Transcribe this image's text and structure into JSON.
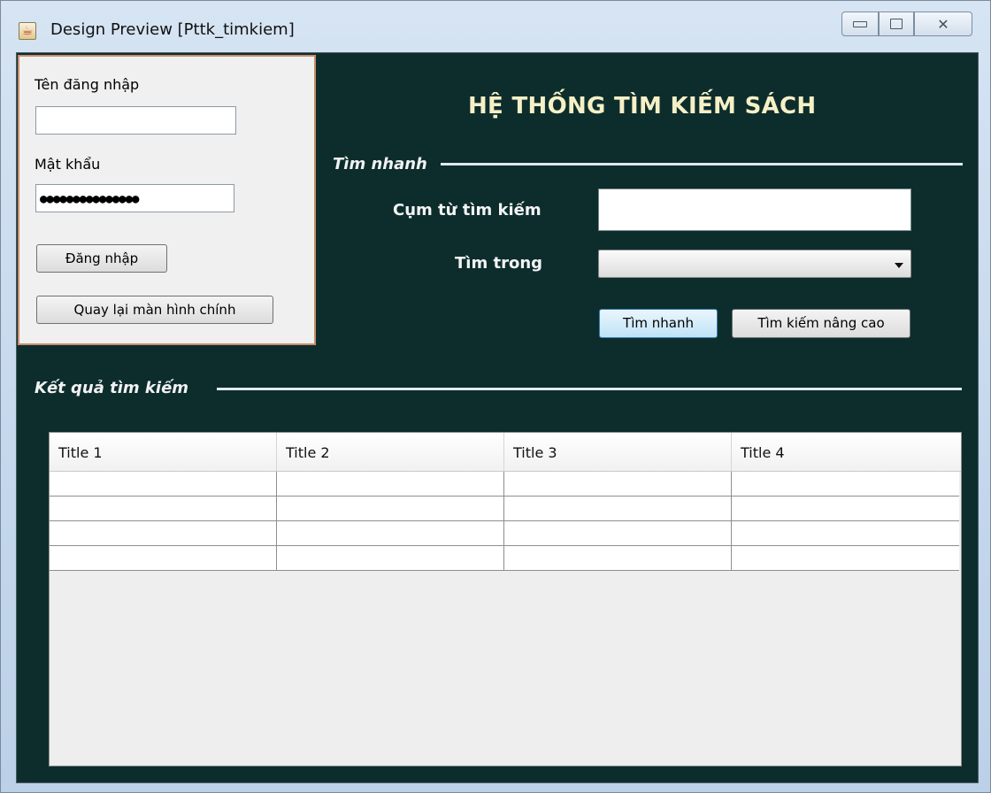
{
  "window": {
    "title": "Design Preview [Pttk_timkiem]",
    "controls": {
      "minimize": "",
      "maximize": "",
      "close": "✕"
    }
  },
  "login": {
    "username_label": "Tên đăng nhập",
    "username_value": "",
    "password_label": "Mật khẩu",
    "password_value": "●●●●●●●●●●●●●●●",
    "login_button": "Đăng nhập",
    "back_button": "Quay lại màn hình chính"
  },
  "main": {
    "heading": "HỆ THỐNG TÌM KIẾM SÁCH",
    "quick_search": {
      "section_label": "Tìm nhanh",
      "phrase_label": "Cụm từ tìm kiếm",
      "phrase_value": "",
      "search_in_label": "Tìm trong",
      "search_in_value": "",
      "quick_button": "Tìm nhanh",
      "advanced_button": "Tìm kiếm nâng cao"
    },
    "results": {
      "section_label": "Kết quả tìm kiếm",
      "columns": [
        "Title 1",
        "Title 2",
        "Title 3",
        "Title 4"
      ],
      "rows": [
        [
          "",
          "",
          "",
          ""
        ],
        [
          "",
          "",
          "",
          ""
        ],
        [
          "",
          "",
          "",
          ""
        ],
        [
          "",
          "",
          "",
          ""
        ]
      ]
    }
  },
  "colors": {
    "background": "#0d2d2d",
    "heading": "#f6f0c6",
    "panel": "#f0f0f0",
    "panel_border": "#c98d6a"
  }
}
